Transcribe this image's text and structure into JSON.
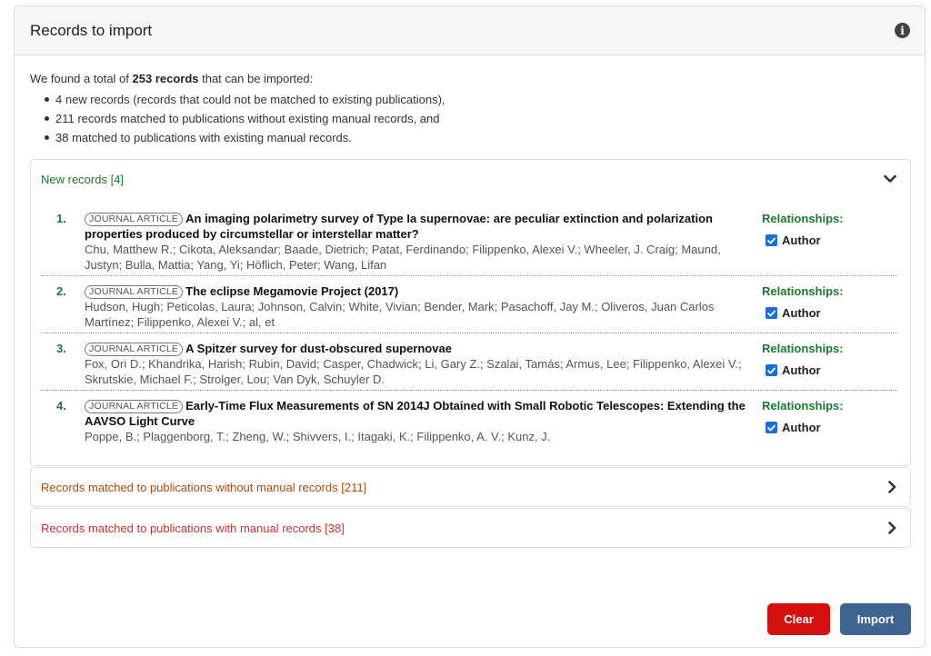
{
  "header": {
    "title": "Records to import",
    "info_icon": "info-circle-icon"
  },
  "summary": {
    "intro_prefix": "We found a total of ",
    "intro_count": "253 records",
    "intro_suffix": " that can be imported:",
    "bullets": [
      "4 new records (records that could not be matched to existing publications),",
      "211 records matched to publications without existing manual records, and",
      "38 matched to publications with existing manual records."
    ]
  },
  "panels": {
    "new": {
      "title": "New records [4]",
      "icon": "chevron-down-icon",
      "color": "#1a7a2e"
    },
    "without_manual": {
      "title": "Records matched to publications without manual records [211]",
      "icon": "chevron-right-icon",
      "color": "#b54708"
    },
    "with_manual": {
      "title": "Records matched to publications with manual records [38]",
      "icon": "chevron-right-icon",
      "color": "#d03030"
    }
  },
  "records": [
    {
      "num": "1.",
      "type": "JOURNAL ARTICLE",
      "title": "An imaging polarimetry survey of Type Ia supernovae: are peculiar extinction and polarization properties produced by circumstellar or interstellar matter?",
      "authors": "Chu, Matthew R.; Cikota, Aleksandar; Baade, Dietrich; Patat, Ferdinando; Filippenko, Alexei V.; Wheeler, J. Craig; Maund, Justyn; Bulla, Mattia; Yang, Yi; Höflich, Peter; Wang, Lifan",
      "rel_label": "Relationships:",
      "rel_value": "Author",
      "checked": true
    },
    {
      "num": "2.",
      "type": "JOURNAL ARTICLE",
      "title": "The eclipse Megamovie Project (2017)",
      "authors": "Hudson, Hugh; Peticolas, Laura; Johnson, Calvin; White, Vivian; Bender, Mark; Pasachoff, Jay M.; Oliveros, Juan Carlos Martínez; Filippenko, Alexei V.; al, et",
      "rel_label": "Relationships:",
      "rel_value": "Author",
      "checked": true
    },
    {
      "num": "3.",
      "type": "JOURNAL ARTICLE",
      "title": "A Spitzer survey for dust-obscured supernovae",
      "authors": "Fox, Ori D.; Khandrika, Harish; Rubin, David; Casper, Chadwick; Li, Gary Z.; Szalai, Tamás; Armus, Lee; Filippenko, Alexei V.; Skrutskie, Michael F.; Strolger, Lou; Van Dyk, Schuyler D.",
      "rel_label": "Relationships:",
      "rel_value": "Author",
      "checked": true
    },
    {
      "num": "4.",
      "type": "JOURNAL ARTICLE",
      "title": "Early-Time Flux Measurements of SN 2014J Obtained with Small Robotic Telescopes: Extending the AAVSO Light Curve",
      "authors": "Poppe, B.; Plaggenborg, T.; Zheng, W.; Shivvers, I.; Itagaki, K.; Filippenko, A. V.; Kunz, J.",
      "rel_label": "Relationships:",
      "rel_value": "Author",
      "checked": true
    }
  ],
  "actions": {
    "clear": "Clear",
    "import": "Import",
    "clear_color": "#d30f0f",
    "import_color": "#3f6491"
  }
}
